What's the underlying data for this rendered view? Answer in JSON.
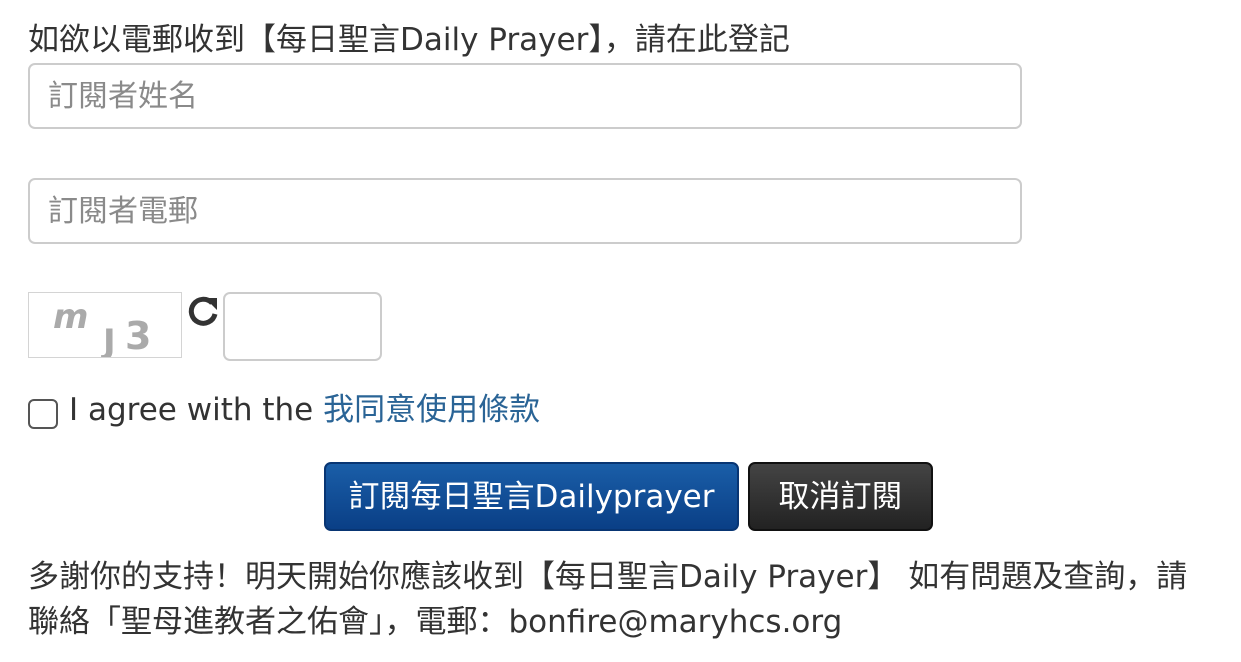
{
  "form": {
    "intro_text": "如欲以電郵收到【每日聖言Daily Prayer】，請在此登記",
    "name_placeholder": "訂閱者姓名",
    "email_placeholder": "訂閱者電郵",
    "captcha": {
      "image_text": "mJ3",
      "refresh_icon": "refresh-icon",
      "input_value": ""
    },
    "agree": {
      "prefix": "I agree with the ",
      "link_text": "我同意使用條款"
    },
    "subscribe_button": "訂閱每日聖言Dailyprayer",
    "cancel_button": "取消訂閱"
  },
  "footer": {
    "line1": "多謝你的支持！明天開始你應該收到【每日聖言Daily Prayer】 如有問題及查詢，請",
    "line2": "聯絡「聖母進教者之佑會」，電郵：bonfire@maryhcs.org"
  },
  "colors": {
    "link": "#2a6496",
    "primary_button": "#0a4a96",
    "dark_button": "#2b2b2b",
    "border": "#cccccc"
  }
}
